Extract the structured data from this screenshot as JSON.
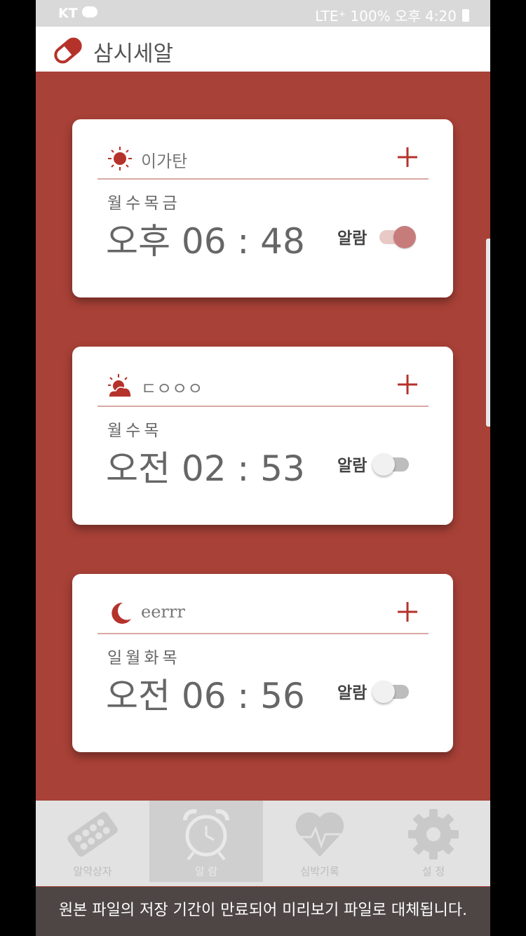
{
  "status_bar": {
    "carrier": "KT",
    "right_text": "LTE⁺ 100%  오후 4:20"
  },
  "app_bar": {
    "title": "삼시세알"
  },
  "alarms": [
    {
      "name": "이가탄",
      "icon": "sun-icon",
      "days": "월수목금",
      "time": "오후 06 : 48",
      "alarm_label": "알람",
      "enabled": true
    },
    {
      "name": "ㄷㅇㅇㅇ",
      "icon": "sunrise-icon",
      "days": "월수목",
      "time": "오전 02 : 53",
      "alarm_label": "알람",
      "enabled": false
    },
    {
      "name": "eerrr",
      "icon": "moon-icon",
      "days": "일월화목",
      "time": "오전 06 : 56",
      "alarm_label": "알람",
      "enabled": false
    }
  ],
  "bottom_nav": [
    {
      "label": "알약상자",
      "icon": "pill-box-icon",
      "active": false
    },
    {
      "label": "알 람",
      "icon": "alarm-clock-icon",
      "active": true
    },
    {
      "label": "심박기록",
      "icon": "heartbeat-icon",
      "active": false
    },
    {
      "label": "설 정",
      "icon": "gear-icon",
      "active": false
    }
  ],
  "banner": {
    "text": "원본 파일의 저장 기간이 만료되어 미리보기 파일로 대체됩니다."
  },
  "colors": {
    "brand_red": "#a84137",
    "toggle_on": "#c77c7c",
    "white": "#ffffff"
  }
}
